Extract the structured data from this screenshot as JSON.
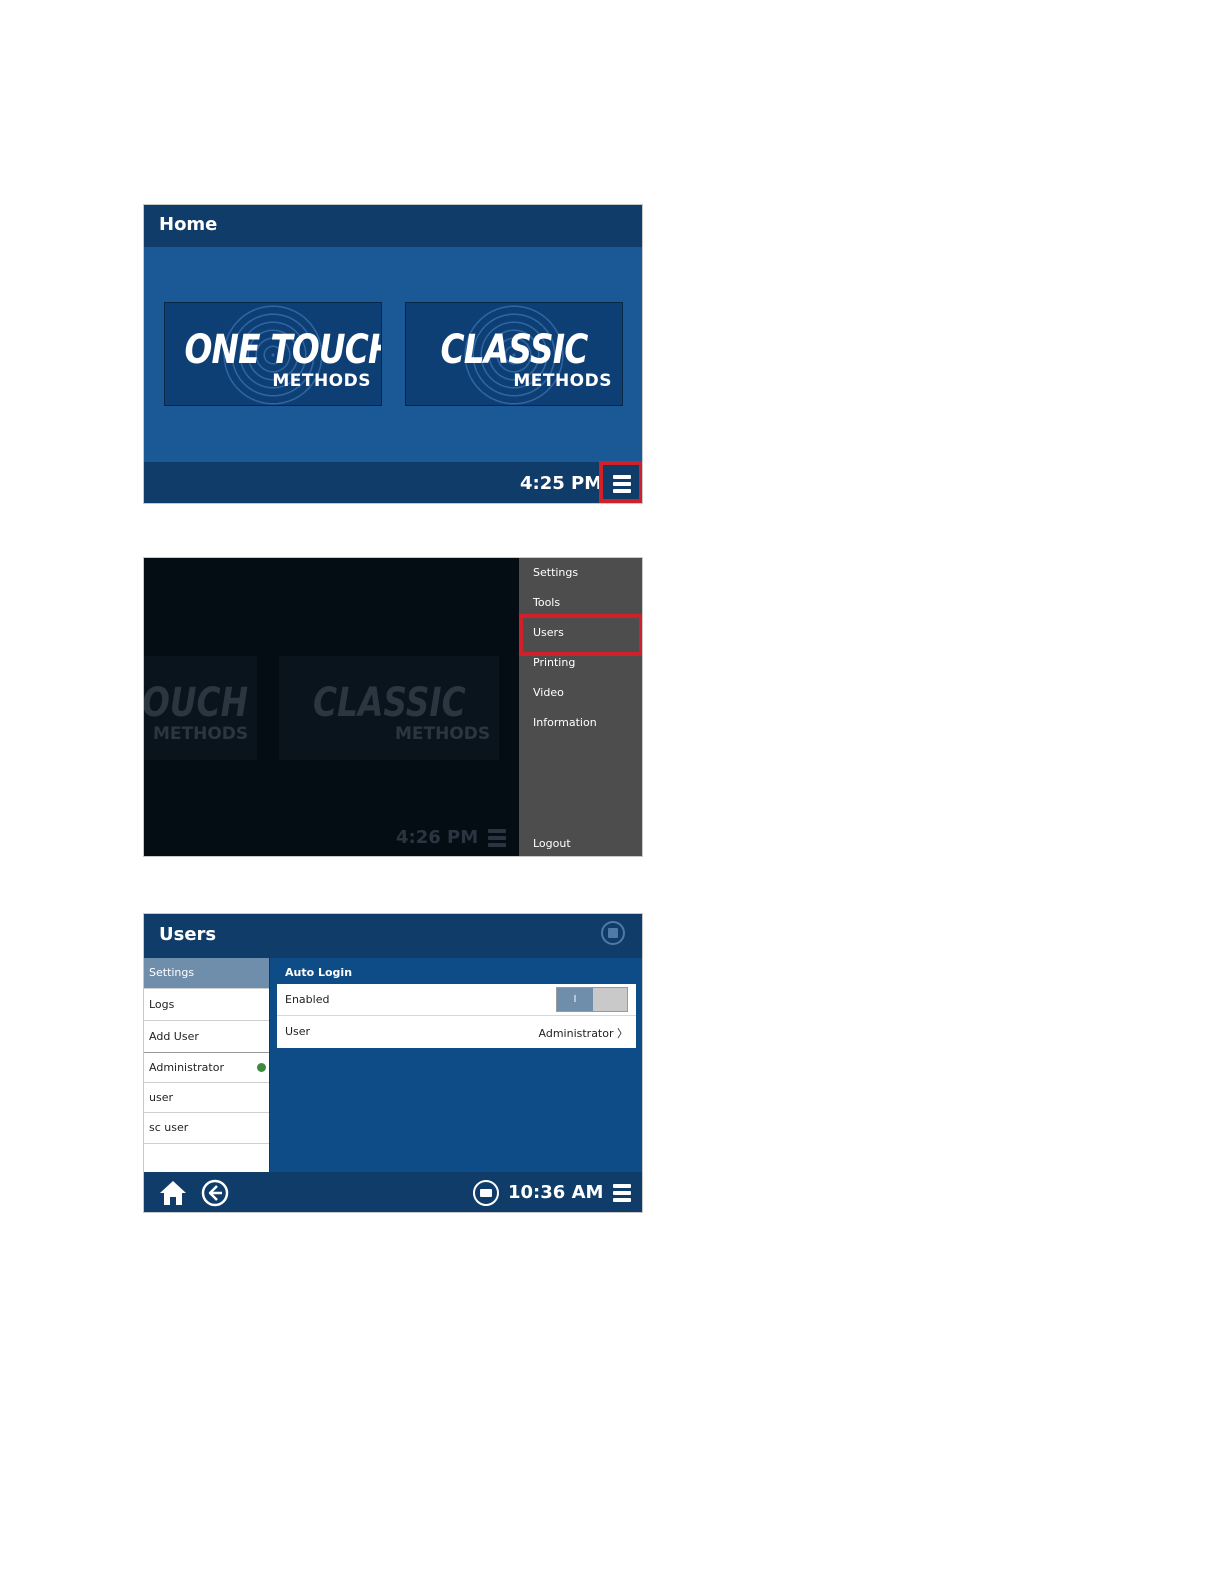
{
  "home_screen": {
    "title": "Home",
    "tiles": [
      {
        "big": "ONE TOUCH",
        "small": "METHODS"
      },
      {
        "big": "CLASSIC",
        "small": "METHODS"
      }
    ],
    "time": "4:25 PM",
    "menu_icon": "hamburger-menu-icon"
  },
  "menu_screen": {
    "tiles": [
      {
        "big": "OUCH",
        "small": "METHODS"
      },
      {
        "big": "CLASSIC",
        "small": "METHODS"
      }
    ],
    "time": "4:26 PM",
    "menu_items": [
      "Settings",
      "Tools",
      "Users",
      "Printing",
      "Video",
      "Information"
    ],
    "logout": "Logout",
    "highlighted_item": "Users"
  },
  "users_screen": {
    "title": "Users",
    "sidebar": {
      "items": [
        "Settings",
        "Logs",
        "Add User",
        "Administrator",
        "user",
        "sc user"
      ],
      "active": "Settings",
      "online_user": "Administrator"
    },
    "section": "Auto Login",
    "rows": {
      "enabled_label": "Enabled",
      "toggle_text": "I",
      "toggle_on": true,
      "user_label": "User",
      "user_value": "Administrator 〉"
    },
    "time": "10:36 AM",
    "icons": [
      "home-icon",
      "back-arrow-icon",
      "printer-icon",
      "hamburger-menu-icon",
      "save-icon"
    ]
  },
  "colors": {
    "accent_blue": "#1a5896",
    "dark_bar": "#0f3c68",
    "highlight_red": "#d0202a",
    "status_green": "#3e8a3e"
  }
}
